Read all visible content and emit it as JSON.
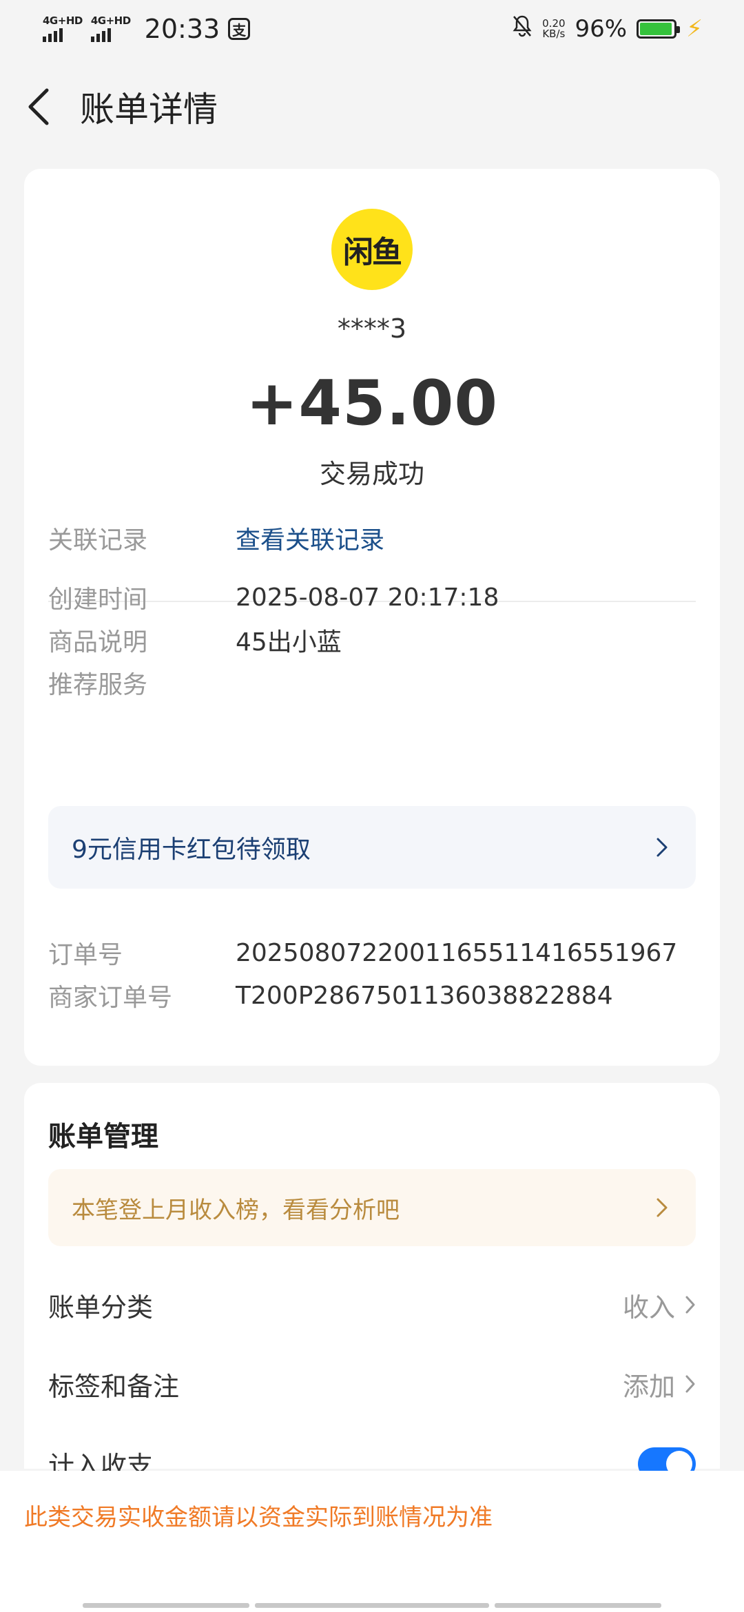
{
  "status_bar": {
    "network1": "4G+HD",
    "network2": "4G+HD",
    "time": "20:33",
    "pay_glyph": "支",
    "speed_value": "0.20",
    "speed_unit": "KB/s",
    "battery": "96%",
    "icons": [
      "signal-icon",
      "bell-off-icon",
      "battery-icon",
      "charging-icon"
    ]
  },
  "nav": {
    "title": "账单详情"
  },
  "summary": {
    "logo_text": "闲鱼",
    "merchant": "****3",
    "amount": "+45.00",
    "status": "交易成功"
  },
  "details": {
    "related_key": "关联记录",
    "related_value": "查看关联记录",
    "created_key": "创建时间",
    "created_value": "2025-08-07 20:17:18",
    "product_key": "商品说明",
    "product_value": "45出小蓝",
    "recommend_key": "推荐服务",
    "promo": "9元信用卡红包待领取",
    "order_key": "订单号",
    "order_value": "2025080722001165511416551967",
    "merchant_order_key": "商家订单号",
    "merchant_order_value": "T200P2867501136038822884"
  },
  "management": {
    "title": "账单管理",
    "tip": "本笔登上月收入榜，看看分析吧",
    "category_label": "账单分类",
    "category_value": "收入",
    "tags_label": "标签和备注",
    "tags_value": "添加",
    "include_label": "计入收支",
    "include_on": true
  },
  "notice": "此类交易实收金额请以资金实际到账情况为准",
  "colors": {
    "link": "#1b4f8a",
    "toggle": "#1677ff",
    "tip_text": "#b98b3e",
    "notice_text": "#f07a26",
    "logo_bg": "#ffe21a"
  }
}
